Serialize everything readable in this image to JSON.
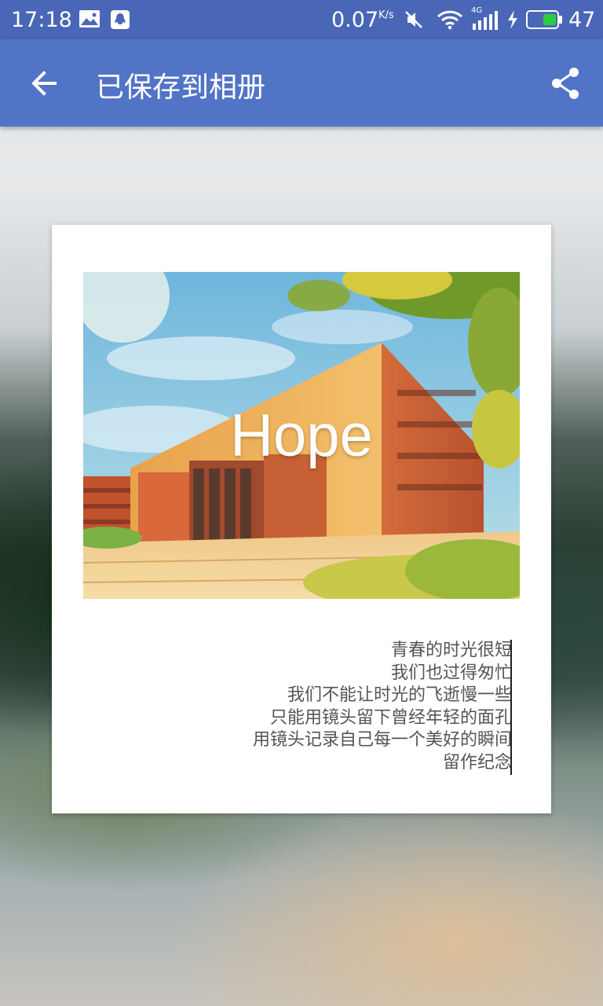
{
  "status_bar": {
    "time": "17:18",
    "net_speed": "0.07",
    "net_unit": "K/s",
    "network_type": "4G",
    "battery": "47",
    "icons": [
      "image-icon",
      "qq-icon",
      "mute-icon",
      "wifi-icon",
      "signal-icon",
      "charging-icon",
      "battery-icon"
    ]
  },
  "app_bar": {
    "title": "已保存到相册",
    "back_icon": "arrow-back-icon",
    "share_icon": "share-icon",
    "color": "#5274c6"
  },
  "card": {
    "image_caption": "Hope",
    "poem": [
      "青春的时光很短",
      "我们也过得匆忙",
      "我们不能让时光的飞逝慢一些",
      "只能用镜头留下曾经年轻的面孔",
      "用镜头记录自己每一个美好的瞬间",
      "留作纪念"
    ]
  }
}
